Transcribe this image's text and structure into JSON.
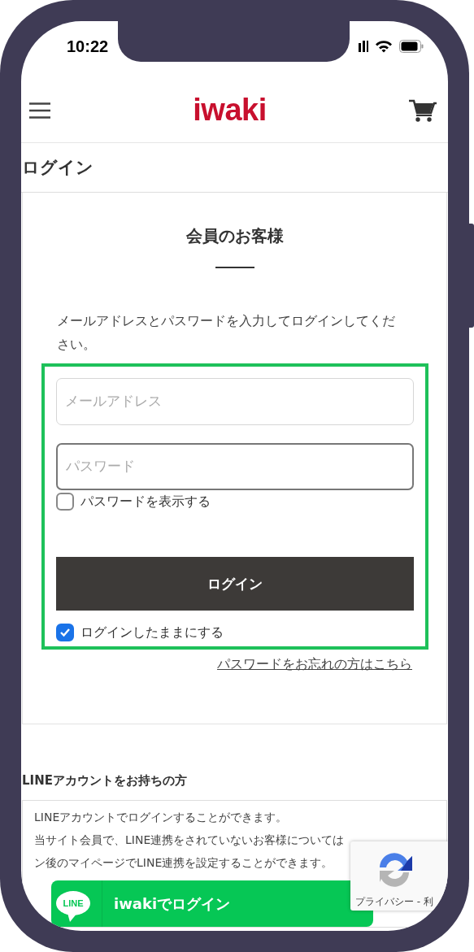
{
  "status_bar": {
    "time": "10:22"
  },
  "header": {
    "logo": "iwaki"
  },
  "page_title": "ログイン",
  "member_section": {
    "heading": "会員のお客様",
    "instructions": "メールアドレスとパスワードを入力してログインしてください。",
    "fields": [
      {
        "placeholder": "メールアドレス",
        "focused": false
      },
      {
        "placeholder": "パスワード",
        "focused": true
      }
    ],
    "show_password": {
      "label": "パスワードを表示する",
      "checked": false
    },
    "login_button": "ログイン",
    "remember": {
      "label": "ログインしたままにする",
      "checked": true
    },
    "forgot_link": "パスワードをお忘れの方はこちら"
  },
  "line_section": {
    "heading": "LINEアカウントをお持ちの方",
    "lines": [
      "LINEアカウントでログインすることができます。",
      "当サイト会員で、LINE連携をされていないお客様については",
      "ン後のマイページでLINE連携を設定することができます。"
    ],
    "logo": "LINE",
    "button": "iwakiでログイン"
  },
  "recaptcha": {
    "text": "プライバシー - 利"
  }
}
